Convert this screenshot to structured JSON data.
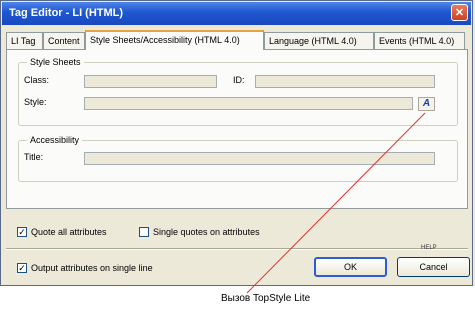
{
  "window": {
    "title": "Tag Editor - LI (HTML)",
    "close_glyph": "✕"
  },
  "tabs": [
    {
      "label": "LI Tag"
    },
    {
      "label": "Content"
    },
    {
      "label": "Style Sheets/Accessibility (HTML 4.0)"
    },
    {
      "label": "Language (HTML 4.0)"
    },
    {
      "label": "Events (HTML 4.0)"
    }
  ],
  "style_sheets": {
    "group_label": "Style Sheets",
    "class_label": "Class:",
    "class_value": "",
    "id_label": "ID:",
    "id_value": "",
    "style_label": "Style:",
    "style_value": "",
    "topstyle_button_glyph": "A"
  },
  "accessibility": {
    "group_label": "Accessibility",
    "title_label": "Title:",
    "title_value": ""
  },
  "options": {
    "quote_all": {
      "label": "Quote all attributes",
      "checked": true,
      "mark": "✓"
    },
    "single_quotes": {
      "label": "Single quotes on attributes",
      "checked": false,
      "mark": ""
    },
    "output_single_line": {
      "label": "Output attributes on single line",
      "checked": true,
      "mark": "✓"
    }
  },
  "help_label": "HELP",
  "buttons": {
    "ok": "OK",
    "cancel": "Cancel"
  },
  "caption": {
    "text": "Вызов TopStyle Lite"
  },
  "colors": {
    "title_bar": "#1e57d0",
    "active_tab_accent": "#e8a33f",
    "callout_line": "#e83030"
  }
}
